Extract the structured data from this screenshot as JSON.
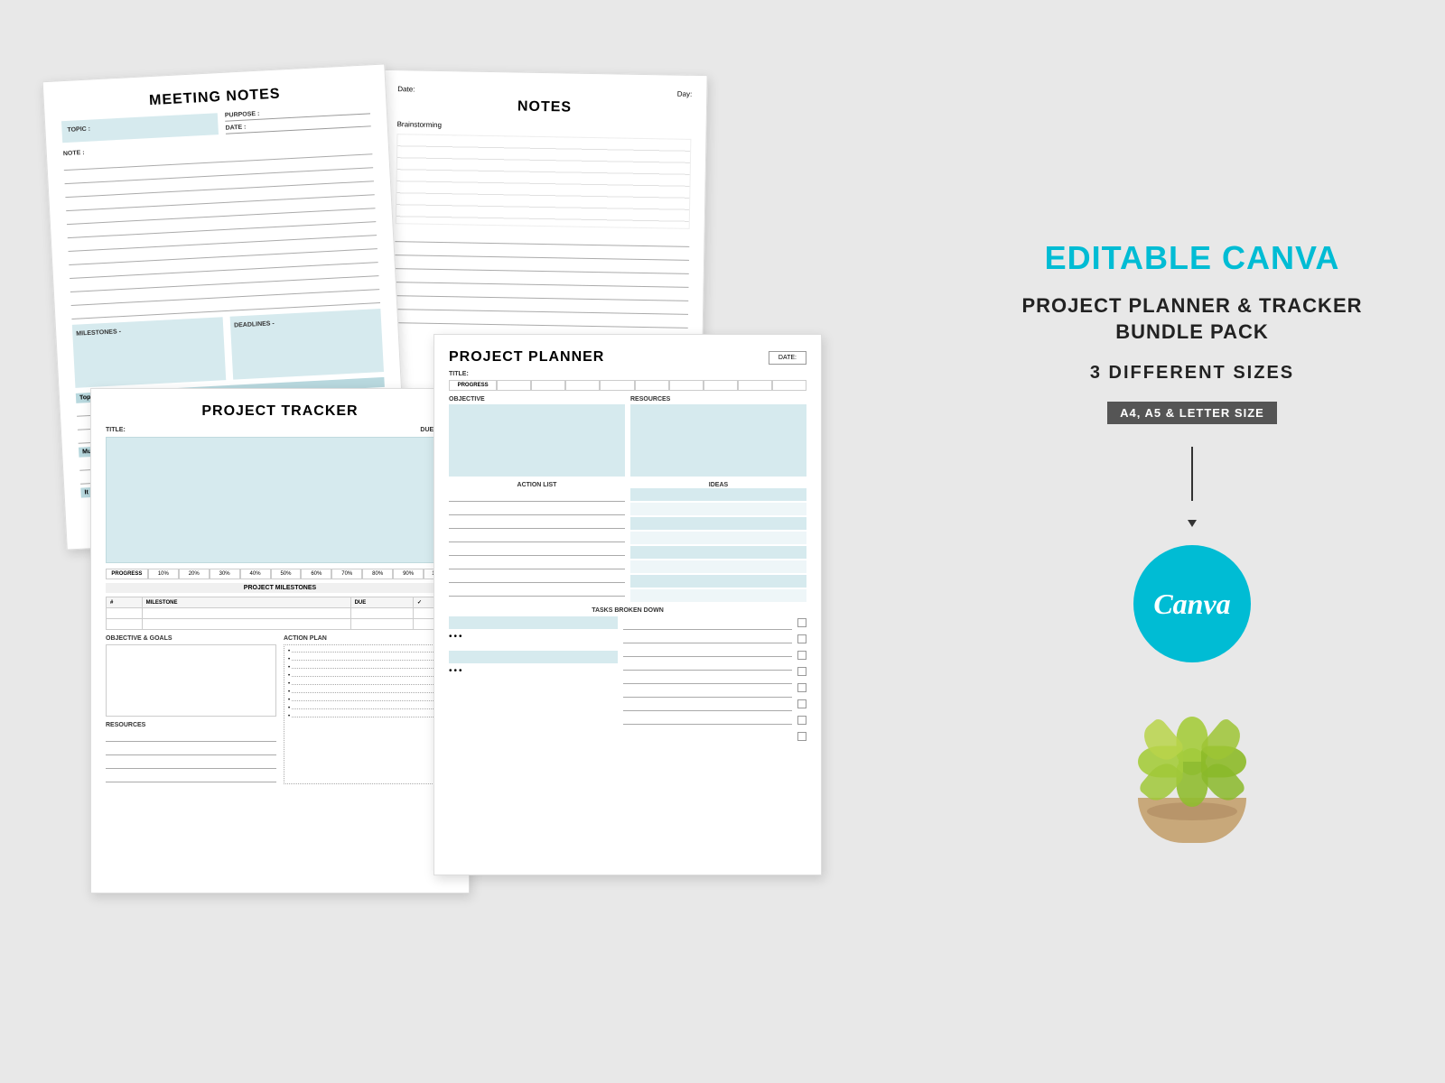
{
  "background": "#e8e8e8",
  "sidebar": {
    "brand_title": "EDITABLE CANVA",
    "subtitle_line1": "PROJECT PLANNER & TRACKER",
    "subtitle_line2": "BUNDLE PACK",
    "size_heading": "3 DIFFERENT SIZES",
    "size_badge": "A4, A5 & LETTER SIZE",
    "canva_logo": "Canva"
  },
  "meeting_notes": {
    "title": "MEETING NOTES",
    "topic_label": "TOPIC :",
    "purpose_label": "PURPOSE :",
    "date_label": "DATE :",
    "note_label": "NOTE :",
    "milestones_label": "MILESTONES -",
    "deadlines_label": "DEADLINES -",
    "top_priorities_label": "Top Priorities",
    "must_label": "Must",
    "it_label": "It C"
  },
  "notes": {
    "title": "NOTES",
    "date_label": "Date:",
    "day_label": "Day:",
    "brainstorming_label": "Brainstorming"
  },
  "project_tracker": {
    "title": "PROJECT TRACKER",
    "title_label": "TITLE:",
    "due_date_label": "DUE DATE:",
    "progress_label": "PROGRESS",
    "progress_values": [
      "10%",
      "20%",
      "30%",
      "40%",
      "50%",
      "60%",
      "70%",
      "80%",
      "90%",
      "100%"
    ],
    "milestones_section": "PROJECT MILESTONES",
    "milestone_col": "MILESTONE",
    "due_col": "DUE",
    "number_col": "#",
    "objective_label": "OBJECTIVE & GOALS",
    "action_plan_label": "ACTION PLAN",
    "resources_label": "RESOURCES"
  },
  "project_planner": {
    "title": "PROJECT PLANNER",
    "date_label": "DATE:",
    "title_label": "TITLE:",
    "progress_label": "PROGRESS",
    "objective_label": "OBJECTIVE",
    "resources_label": "RESOURCES",
    "action_list_label": "ACTION LIST",
    "ideas_label": "IDEAS",
    "tasks_label": "TASKS BROKEN DOWN"
  }
}
